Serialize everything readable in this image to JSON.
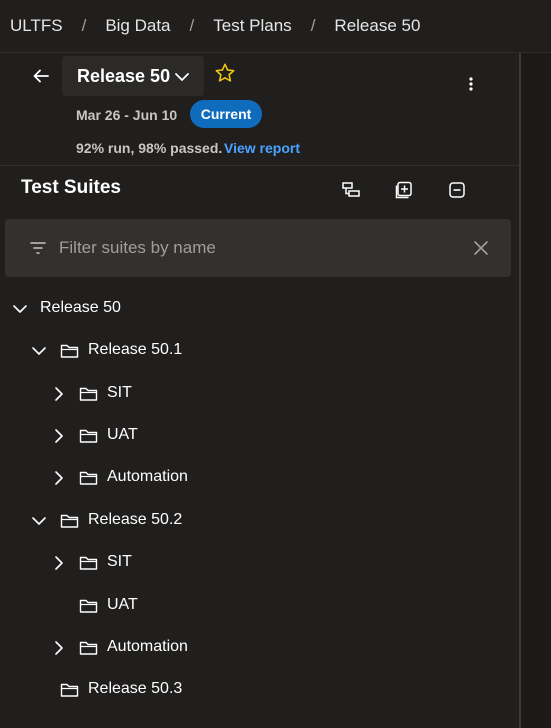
{
  "breadcrumb": {
    "items": [
      "ULTFS",
      "Big Data",
      "Test Plans",
      "Release 50"
    ],
    "separator": "/"
  },
  "plan": {
    "name": "Release 50",
    "dates": "Mar 26 - Jun 10",
    "status_badge": "Current",
    "run_stats": "92% run, 98% passed.",
    "view_report_label": "View report"
  },
  "suites": {
    "title": "Test Suites",
    "toolbar_icons": [
      "new-suite-icon",
      "expand-all-icon",
      "collapse-all-icon"
    ],
    "filter_placeholder": "Filter suites by name",
    "filter_value": ""
  },
  "tree": [
    {
      "label": "Release 50",
      "level": 0,
      "expandable": true,
      "expanded": true,
      "folder": false
    },
    {
      "label": "Release 50.1",
      "level": 1,
      "expandable": true,
      "expanded": true,
      "folder": true
    },
    {
      "label": "SIT",
      "level": 2,
      "expandable": true,
      "expanded": false,
      "folder": true
    },
    {
      "label": "UAT",
      "level": 2,
      "expandable": true,
      "expanded": false,
      "folder": true
    },
    {
      "label": "Automation",
      "level": 2,
      "expandable": true,
      "expanded": false,
      "folder": true
    },
    {
      "label": "Release 50.2",
      "level": 1,
      "expandable": true,
      "expanded": true,
      "folder": true
    },
    {
      "label": "SIT",
      "level": 2,
      "expandable": true,
      "expanded": false,
      "folder": true
    },
    {
      "label": "UAT",
      "level": 2,
      "expandable": false,
      "expanded": false,
      "folder": true
    },
    {
      "label": "Automation",
      "level": 2,
      "expandable": true,
      "expanded": false,
      "folder": true
    },
    {
      "label": "Release 50.3",
      "level": 1,
      "expandable": false,
      "expanded": false,
      "folder": true
    }
  ],
  "colors": {
    "background": "#201f1e",
    "accent": "#0f6cbd",
    "link": "#4aa3ff",
    "star": "#f2c811"
  }
}
